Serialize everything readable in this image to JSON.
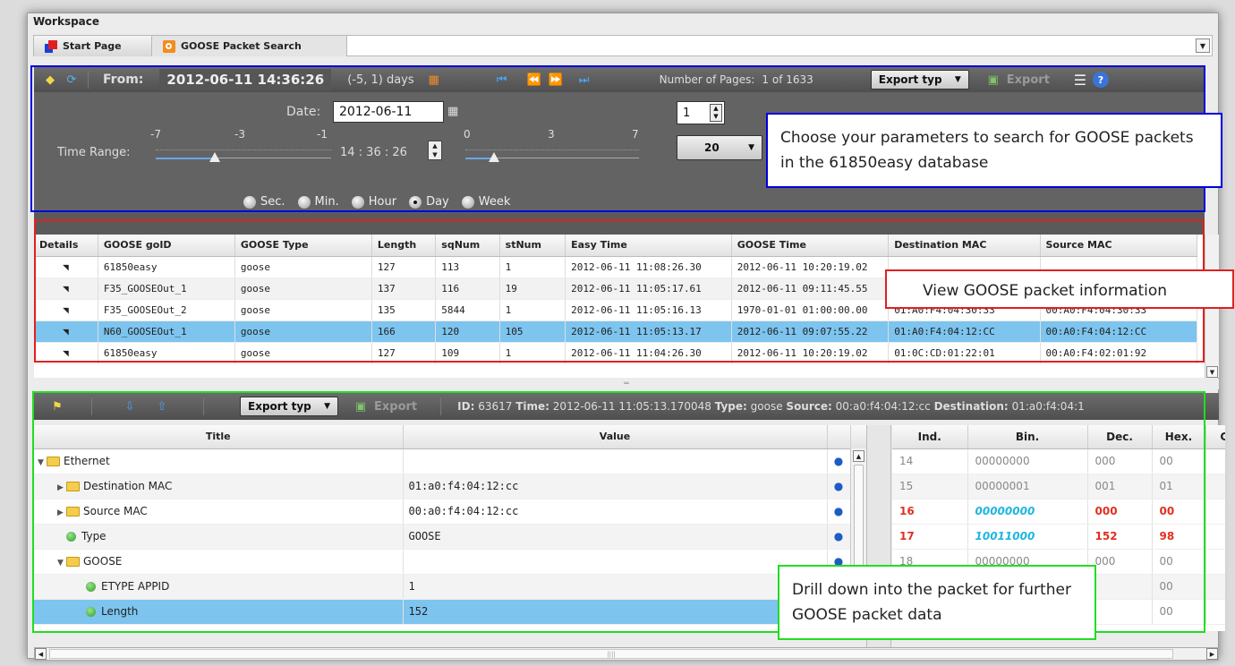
{
  "workspace": {
    "title": "Workspace"
  },
  "tabs": [
    {
      "label": "Start Page"
    },
    {
      "label": "GOOSE Packet Search"
    }
  ],
  "search": {
    "from_label": "From:",
    "from_value": "2012-06-11 14:36:26",
    "range_text": "(-5, 1) days",
    "pages_label": "Number of Pages:",
    "pages_value": "1 of 1633",
    "export_type_label": "Export typ",
    "export_label": "Export",
    "date_label": "Date:",
    "date_value": "2012-06-11",
    "page_number": "1",
    "page_size": "20",
    "time_range_label": "Time Range:",
    "slider_left_ticks": [
      "-7",
      "-3",
      "-1"
    ],
    "slider_right_ticks": [
      "0",
      "3",
      "7"
    ],
    "time_value": "14 : 36 : 26",
    "units": [
      {
        "label": "Sec.",
        "selected": false
      },
      {
        "label": "Min.",
        "selected": false
      },
      {
        "label": "Hour",
        "selected": false
      },
      {
        "label": "Day",
        "selected": true
      },
      {
        "label": "Week",
        "selected": false
      }
    ]
  },
  "packets": {
    "columns": [
      "Details",
      "GOOSE goID",
      "GOOSE Type",
      "Length",
      "sqNum",
      "stNum",
      "Easy Time",
      "GOOSE Time",
      "Destination MAC",
      "Source MAC"
    ],
    "rows": [
      [
        "61850easy",
        "goose",
        "127",
        "113",
        "1",
        "2012-06-11 11:08:26.30",
        "2012-06-11 10:20:19.02",
        "",
        ""
      ],
      [
        "F35_GOOSEOut_1",
        "goose",
        "137",
        "116",
        "19",
        "2012-06-11 11:05:17.61",
        "2012-06-11 09:11:45.55",
        "",
        ""
      ],
      [
        "F35_GOOSEOut_2",
        "goose",
        "135",
        "5844",
        "1",
        "2012-06-11 11:05:16.13",
        "1970-01-01 01:00:00.00",
        "01:A0:F4:04:30:33",
        "00:A0:F4:04:30:33"
      ],
      [
        "N60_GOOSEOut_1",
        "goose",
        "166",
        "120",
        "105",
        "2012-06-11 11:05:13.17",
        "2012-06-11 09:07:55.22",
        "01:A0:F4:04:12:CC",
        "00:A0:F4:04:12:CC"
      ],
      [
        "61850easy",
        "goose",
        "127",
        "109",
        "1",
        "2012-06-11 11:04:26.30",
        "2012-06-11 10:20:19.02",
        "01:0C:CD:01:22:01",
        "00:A0:F4:02:01:92"
      ]
    ],
    "selected_index": 3
  },
  "detail_bar": {
    "export_type_label": "Export typ",
    "export_label": "Export",
    "id_label": "ID:",
    "id_value": "63617",
    "time_label": "Time:",
    "time_value": "2012-06-11 11:05:13.170048",
    "type_label": "Type:",
    "type_value": "goose",
    "source_label": "Source:",
    "source_value": "00:a0:f4:04:12:cc",
    "dest_label": "Destination:",
    "dest_value": "01:a0:f4:04:1"
  },
  "tree": {
    "columns": [
      "Title",
      "Value"
    ],
    "rows": [
      {
        "title": "Ethernet",
        "value": "",
        "kind": "folder-open",
        "level": 0
      },
      {
        "title": "Destination MAC",
        "value": "01:a0:f4:04:12:cc",
        "kind": "folder",
        "level": 1
      },
      {
        "title": "Source MAC",
        "value": "00:a0:f4:04:12:cc",
        "kind": "folder",
        "level": 1
      },
      {
        "title": "Type",
        "value": "GOOSE",
        "kind": "leaf",
        "level": 1
      },
      {
        "title": "GOOSE",
        "value": "",
        "kind": "folder-open",
        "level": 1
      },
      {
        "title": "ETYPE APPID",
        "value": "1",
        "kind": "leaf",
        "level": 2
      },
      {
        "title": "Length",
        "value": "152",
        "kind": "leaf",
        "level": 2
      }
    ],
    "selected_index": 6
  },
  "hex": {
    "columns": [
      "Ind.",
      "Bin.",
      "Dec.",
      "Hex.",
      "Ch"
    ],
    "rows": [
      [
        "14",
        "00000000",
        "000",
        "00"
      ],
      [
        "15",
        "00000001",
        "001",
        "01"
      ],
      [
        "16",
        "00000000",
        "000",
        "00"
      ],
      [
        "17",
        "10011000",
        "152",
        "98"
      ],
      [
        "18",
        "00000000",
        "000",
        "00"
      ],
      [
        "",
        "",
        "",
        "00"
      ],
      [
        "",
        "",
        "",
        "00"
      ]
    ],
    "highlight": [
      2,
      3
    ]
  },
  "callouts": {
    "search": "Choose your parameters to search for GOOSE packets in the 61850easy database",
    "info": "View GOOSE packet information",
    "drill": "Drill down into the packet for further GOOSE packet data"
  },
  "colors": {
    "search_box": "#0000dd",
    "info_box": "#e02020",
    "drill_box": "#22dd22",
    "selection": "#7dc4ef"
  }
}
